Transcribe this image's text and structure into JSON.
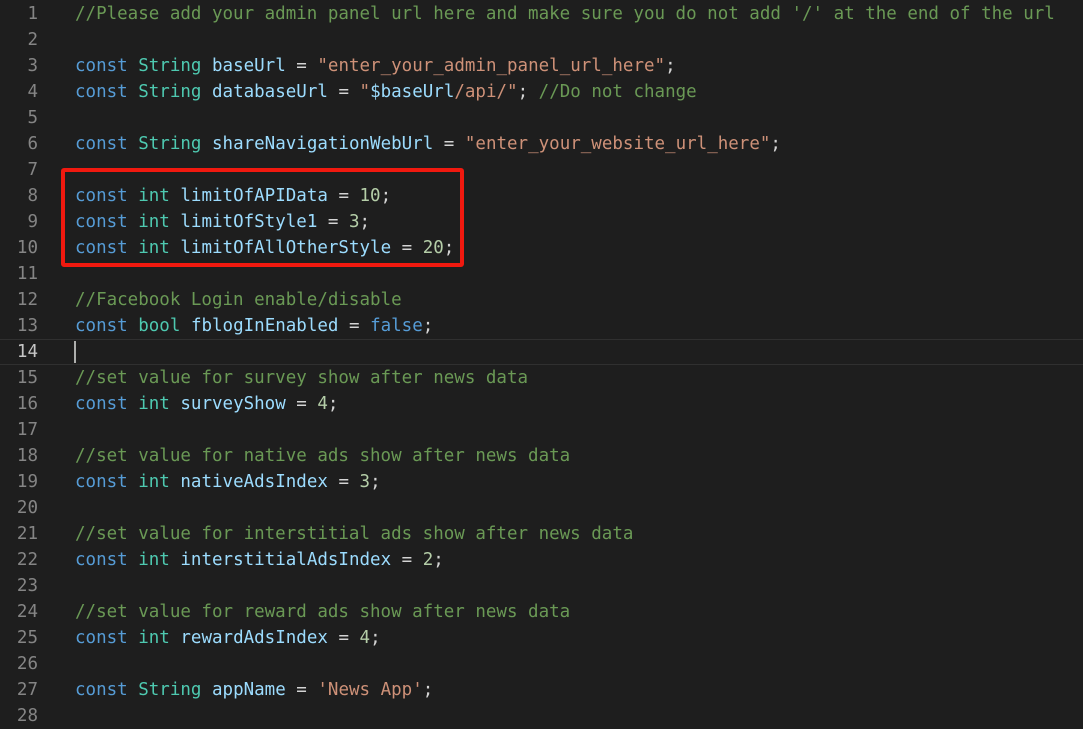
{
  "editor": {
    "lines": [
      {
        "n": "1",
        "tokens": [
          {
            "t": "//Please add your admin panel url here and make sure you do not add '/' at the end of the url",
            "c": "cm"
          }
        ]
      },
      {
        "n": "2",
        "tokens": []
      },
      {
        "n": "3",
        "tokens": [
          {
            "t": "const",
            "c": "kw"
          },
          {
            "t": " ",
            "c": "op"
          },
          {
            "t": "String",
            "c": "ty"
          },
          {
            "t": " ",
            "c": "op"
          },
          {
            "t": "baseUrl",
            "c": "id"
          },
          {
            "t": " = ",
            "c": "op"
          },
          {
            "t": "\"enter_your_admin_panel_url_here\"",
            "c": "str"
          },
          {
            "t": ";",
            "c": "op"
          }
        ]
      },
      {
        "n": "4",
        "tokens": [
          {
            "t": "const",
            "c": "kw"
          },
          {
            "t": " ",
            "c": "op"
          },
          {
            "t": "String",
            "c": "ty"
          },
          {
            "t": " ",
            "c": "op"
          },
          {
            "t": "databaseUrl",
            "c": "id"
          },
          {
            "t": " = ",
            "c": "op"
          },
          {
            "t": "\"",
            "c": "str"
          },
          {
            "t": "$baseUrl",
            "c": "id"
          },
          {
            "t": "/api/\"",
            "c": "str"
          },
          {
            "t": "; ",
            "c": "op"
          },
          {
            "t": "//Do not change",
            "c": "cm"
          }
        ]
      },
      {
        "n": "5",
        "tokens": []
      },
      {
        "n": "6",
        "tokens": [
          {
            "t": "const",
            "c": "kw"
          },
          {
            "t": " ",
            "c": "op"
          },
          {
            "t": "String",
            "c": "ty"
          },
          {
            "t": " ",
            "c": "op"
          },
          {
            "t": "shareNavigationWebUrl",
            "c": "id"
          },
          {
            "t": " = ",
            "c": "op"
          },
          {
            "t": "\"enter_your_website_url_here\"",
            "c": "str"
          },
          {
            "t": ";",
            "c": "op"
          }
        ]
      },
      {
        "n": "7",
        "tokens": []
      },
      {
        "n": "8",
        "tokens": [
          {
            "t": "const",
            "c": "kw"
          },
          {
            "t": " ",
            "c": "op"
          },
          {
            "t": "int",
            "c": "ty"
          },
          {
            "t": " ",
            "c": "op"
          },
          {
            "t": "limitOfAPIData",
            "c": "id"
          },
          {
            "t": " = ",
            "c": "op"
          },
          {
            "t": "10",
            "c": "num"
          },
          {
            "t": ";",
            "c": "op"
          }
        ]
      },
      {
        "n": "9",
        "tokens": [
          {
            "t": "const",
            "c": "kw"
          },
          {
            "t": " ",
            "c": "op"
          },
          {
            "t": "int",
            "c": "ty"
          },
          {
            "t": " ",
            "c": "op"
          },
          {
            "t": "limitOfStyle1",
            "c": "id"
          },
          {
            "t": " = ",
            "c": "op"
          },
          {
            "t": "3",
            "c": "num"
          },
          {
            "t": ";",
            "c": "op"
          }
        ]
      },
      {
        "n": "10",
        "tokens": [
          {
            "t": "const",
            "c": "kw"
          },
          {
            "t": " ",
            "c": "op"
          },
          {
            "t": "int",
            "c": "ty"
          },
          {
            "t": " ",
            "c": "op"
          },
          {
            "t": "limitOfAllOtherStyle",
            "c": "id"
          },
          {
            "t": " = ",
            "c": "op"
          },
          {
            "t": "20",
            "c": "num"
          },
          {
            "t": ";",
            "c": "op"
          }
        ]
      },
      {
        "n": "11",
        "tokens": []
      },
      {
        "n": "12",
        "tokens": [
          {
            "t": "//Facebook Login enable/disable",
            "c": "cm"
          }
        ]
      },
      {
        "n": "13",
        "tokens": [
          {
            "t": "const",
            "c": "kw"
          },
          {
            "t": " ",
            "c": "op"
          },
          {
            "t": "bool",
            "c": "ty"
          },
          {
            "t": " ",
            "c": "op"
          },
          {
            "t": "fblogInEnabled",
            "c": "id"
          },
          {
            "t": " = ",
            "c": "op"
          },
          {
            "t": "false",
            "c": "kw"
          },
          {
            "t": ";",
            "c": "op"
          }
        ]
      },
      {
        "n": "14",
        "tokens": [],
        "active": true
      },
      {
        "n": "15",
        "tokens": [
          {
            "t": "//set value for survey show after news data",
            "c": "cm"
          }
        ]
      },
      {
        "n": "16",
        "tokens": [
          {
            "t": "const",
            "c": "kw"
          },
          {
            "t": " ",
            "c": "op"
          },
          {
            "t": "int",
            "c": "ty"
          },
          {
            "t": " ",
            "c": "op"
          },
          {
            "t": "surveyShow",
            "c": "id"
          },
          {
            "t": " = ",
            "c": "op"
          },
          {
            "t": "4",
            "c": "num"
          },
          {
            "t": ";",
            "c": "op"
          }
        ]
      },
      {
        "n": "17",
        "tokens": []
      },
      {
        "n": "18",
        "tokens": [
          {
            "t": "//set value for native ads show after news data",
            "c": "cm"
          }
        ]
      },
      {
        "n": "19",
        "tokens": [
          {
            "t": "const",
            "c": "kw"
          },
          {
            "t": " ",
            "c": "op"
          },
          {
            "t": "int",
            "c": "ty"
          },
          {
            "t": " ",
            "c": "op"
          },
          {
            "t": "nativeAdsIndex",
            "c": "id"
          },
          {
            "t": " = ",
            "c": "op"
          },
          {
            "t": "3",
            "c": "num"
          },
          {
            "t": ";",
            "c": "op"
          }
        ]
      },
      {
        "n": "20",
        "tokens": []
      },
      {
        "n": "21",
        "tokens": [
          {
            "t": "//set value for interstitial ads show after news data",
            "c": "cm"
          }
        ]
      },
      {
        "n": "22",
        "tokens": [
          {
            "t": "const",
            "c": "kw"
          },
          {
            "t": " ",
            "c": "op"
          },
          {
            "t": "int",
            "c": "ty"
          },
          {
            "t": " ",
            "c": "op"
          },
          {
            "t": "interstitialAdsIndex",
            "c": "id"
          },
          {
            "t": " = ",
            "c": "op"
          },
          {
            "t": "2",
            "c": "num"
          },
          {
            "t": ";",
            "c": "op"
          }
        ]
      },
      {
        "n": "23",
        "tokens": []
      },
      {
        "n": "24",
        "tokens": [
          {
            "t": "//set value for reward ads show after news data",
            "c": "cm"
          }
        ]
      },
      {
        "n": "25",
        "tokens": [
          {
            "t": "const",
            "c": "kw"
          },
          {
            "t": " ",
            "c": "op"
          },
          {
            "t": "int",
            "c": "ty"
          },
          {
            "t": " ",
            "c": "op"
          },
          {
            "t": "rewardAdsIndex",
            "c": "id"
          },
          {
            "t": " = ",
            "c": "op"
          },
          {
            "t": "4",
            "c": "num"
          },
          {
            "t": ";",
            "c": "op"
          }
        ]
      },
      {
        "n": "26",
        "tokens": []
      },
      {
        "n": "27",
        "tokens": [
          {
            "t": "const",
            "c": "kw"
          },
          {
            "t": " ",
            "c": "op"
          },
          {
            "t": "String",
            "c": "ty"
          },
          {
            "t": " ",
            "c": "op"
          },
          {
            "t": "appName",
            "c": "id"
          },
          {
            "t": " = ",
            "c": "op"
          },
          {
            "t": "'News App'",
            "c": "str"
          },
          {
            "t": ";",
            "c": "op"
          }
        ]
      },
      {
        "n": "28",
        "tokens": []
      }
    ],
    "colors": {
      "background": "#1e1e1e",
      "keyword": "#569cd6",
      "type": "#4ec9b0",
      "identifier": "#9cdcfe",
      "string": "#ce9178",
      "number": "#b5cea8",
      "comment": "#6a9955",
      "line_number": "#858585",
      "highlight_box": "#f0190f"
    },
    "highlight": {
      "from_line": "8",
      "to_line": "10"
    }
  }
}
